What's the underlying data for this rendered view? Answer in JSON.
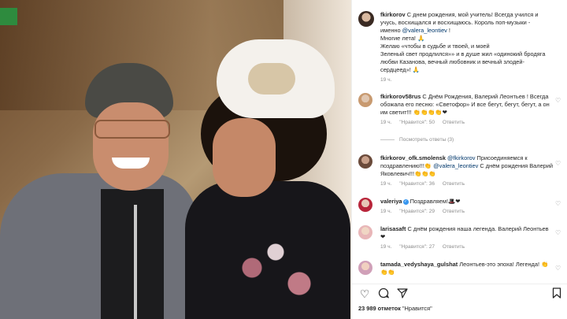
{
  "post": {
    "author": "fkirkorov",
    "caption_lines": [
      "С днем рождения, мой учитель! Всегда учился и",
      "учусь, восхищался и восхищаюсь. Король поп-музыки -",
      "именно ",
      "@valera_leontiev",
      " !",
      "Многие лета! 🙏",
      "Желаю «чтобы в судьбе и твоей, и моей",
      "Зеленый свет продлился»» и в душе жил «одинокий бродяга",
      "любви Казанова, вечный любовник и вечный злодей-",
      "сердцеед»! 🙏"
    ],
    "time": "19 ч."
  },
  "comments": [
    {
      "user": "fkirkorov58rus",
      "text": "С Днём Рождения, Валерий Леонтьев ! Всегда обожала его песню: «Светофор» И все бегут, бегут, бегут, а он им светит!!! 👏👏👏👏❤",
      "time": "19 ч.",
      "likes": "\"Нравится\": 50",
      "reply": "Ответить",
      "view_replies": "Посмотреть ответы (3)"
    },
    {
      "user": "fkirkorov_ofk.smolensk",
      "mention": "@fkirkorov",
      "text": " Присоединяемся к поздравлению!!!👏 ",
      "mention2": "@valera_leontiev",
      "text2": " С днём рождения Валерий Яковлевич!!!",
      "text3": "👏👏👏",
      "time": "19 ч.",
      "likes": "\"Нравится\": 36",
      "reply": "Ответить"
    },
    {
      "user": "valeriya",
      "text": " Поздравляем!🎩❤",
      "time": "19 ч.",
      "likes": "\"Нравится\": 29",
      "reply": "Ответить"
    },
    {
      "user": "larisasaft",
      "text": " С днём рождения наша легенда. Валерий Леонтьев ❤",
      "time": "19 ч.",
      "likes": "\"Нравится\": 27",
      "reply": "Ответить"
    },
    {
      "user": "tamada_vedyshaya_gulshat",
      "text": " Леонтьев-это эпоха! Легенда! 👏👏👏",
      "time": "",
      "likes": "",
      "reply": ""
    }
  ],
  "likes_count": "23 989 отметок",
  "likes_label": "\"Нравится\"",
  "icons": [
    "heart-icon",
    "comment-icon",
    "share-icon",
    "bookmark-icon"
  ],
  "colors": {
    "mention": "#00376b",
    "verified": "#3897f0",
    "muted": "#8e8e8e"
  }
}
